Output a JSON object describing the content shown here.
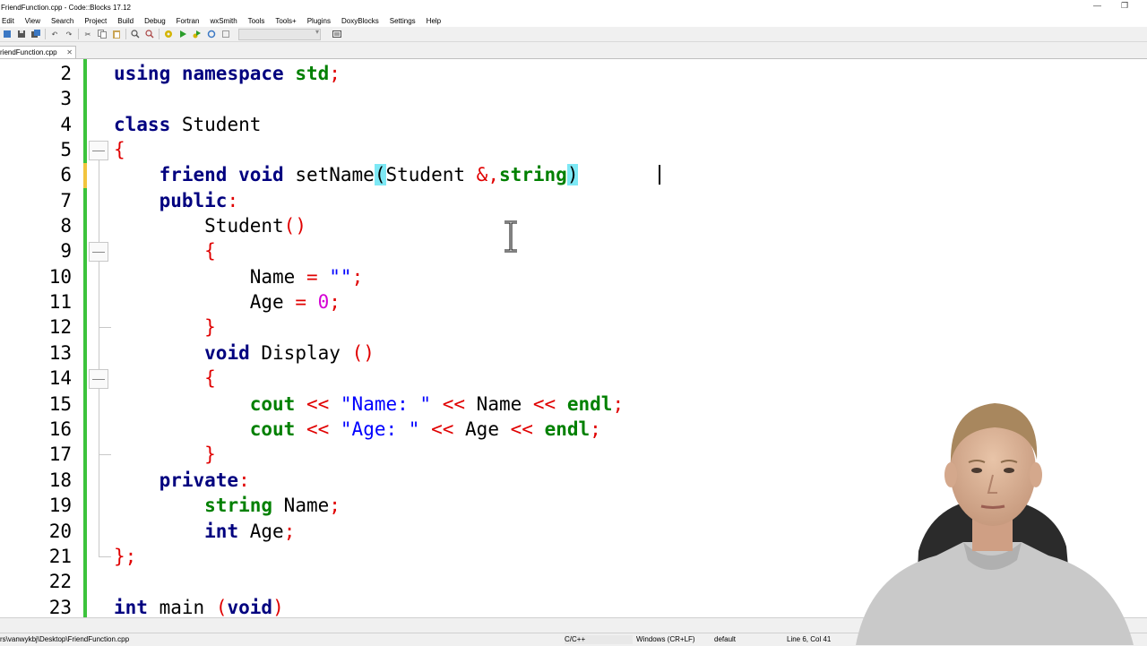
{
  "window": {
    "title": "FriendFunction.cpp - Code::Blocks 17.12",
    "minimize_glyph": "—",
    "restore_glyph": "❐"
  },
  "menu": [
    "Edit",
    "View",
    "Search",
    "Project",
    "Build",
    "Debug",
    "Fortran",
    "wxSmith",
    "Tools",
    "Tools+",
    "Plugins",
    "DoxyBlocks",
    "Settings",
    "Help"
  ],
  "toolbar": {
    "icons": [
      "new-file-icon",
      "save-icon",
      "save-all-icon",
      "undo-icon",
      "redo-icon",
      "cut-icon",
      "copy-icon",
      "paste-icon",
      "find-icon",
      "replace-icon",
      "build-icon",
      "run-icon",
      "build-run-icon",
      "rebuild-icon",
      "abort-icon",
      "build-target-combo",
      "toggle-icon"
    ]
  },
  "tab": {
    "label": "riendFunction.cpp",
    "close_glyph": "✕"
  },
  "editor": {
    "lines": [
      {
        "num": "2"
      },
      {
        "num": "3"
      },
      {
        "num": "4"
      },
      {
        "num": "5"
      },
      {
        "num": "6"
      },
      {
        "num": "7"
      },
      {
        "num": "8"
      },
      {
        "num": "9"
      },
      {
        "num": "10"
      },
      {
        "num": "11"
      },
      {
        "num": "12"
      },
      {
        "num": "13"
      },
      {
        "num": "14"
      },
      {
        "num": "15"
      },
      {
        "num": "16"
      },
      {
        "num": "17"
      },
      {
        "num": "18"
      },
      {
        "num": "19"
      },
      {
        "num": "20"
      },
      {
        "num": "21"
      },
      {
        "num": "22"
      },
      {
        "num": "23"
      }
    ],
    "code": {
      "l2_kw1": "using",
      "l2_kw2": "namespace",
      "l2_id": "std",
      "l2_semi": ";",
      "l4_kw": "class",
      "l4_id": "Student",
      "l5_brace": "{",
      "l6_kw1": "friend",
      "l6_kw2": "void",
      "l6_id": "setName",
      "l6_lp": "(",
      "l6_cls": "Student",
      "l6_amp": "&,",
      "l6_str": "string",
      "l6_rp": ")",
      "l7_kw": "public",
      "l7_colon": ":",
      "l8_id": "Student",
      "l8_parens": "()",
      "l9_brace": "{",
      "l10_id": "Name",
      "l10_eq": "=",
      "l10_str": "\"\"",
      "l10_semi": ";",
      "l11_id": "Age",
      "l11_eq": "=",
      "l11_num": "0",
      "l11_semi": ";",
      "l12_brace": "}",
      "l13_kw": "void",
      "l13_id": "Display",
      "l13_parens": "()",
      "l14_brace": "{",
      "l15_cout": "cout",
      "l15_op1": "<<",
      "l15_str": "\"Name: \"",
      "l15_op2": "<<",
      "l15_id": "Name",
      "l15_op3": "<<",
      "l15_endl": "endl",
      "l15_semi": ";",
      "l16_cout": "cout",
      "l16_op1": "<<",
      "l16_str": "\"Age: \"",
      "l16_op2": "<<",
      "l16_id": "Age",
      "l16_op3": "<<",
      "l16_endl": "endl",
      "l16_semi": ";",
      "l17_brace": "}",
      "l18_kw": "private",
      "l18_colon": ":",
      "l19_type": "string",
      "l19_id": "Name",
      "l19_semi": ";",
      "l20_type": "int",
      "l20_id": "Age",
      "l20_semi": ";",
      "l21_brace": "};",
      "l23_type": "int",
      "l23_id": "main",
      "l23_lp": "(",
      "l23_kw": "void",
      "l23_rp": ")"
    }
  },
  "statusbar": {
    "path": "rs\\vanwykbj\\Desktop\\FriendFunction.cpp",
    "language": "C/C++",
    "eol": "Windows (CR+LF)",
    "encoding": "default",
    "position": "Line 6, Col 41"
  },
  "colors": {
    "keyword": "#00007f",
    "type": "#008000",
    "operator": "#e00000",
    "string": "#0000ff",
    "number": "#d400d4",
    "brace_highlight": "#7de8f5",
    "change_saved": "#3cc33c",
    "change_unsaved": "#f2c43d"
  }
}
